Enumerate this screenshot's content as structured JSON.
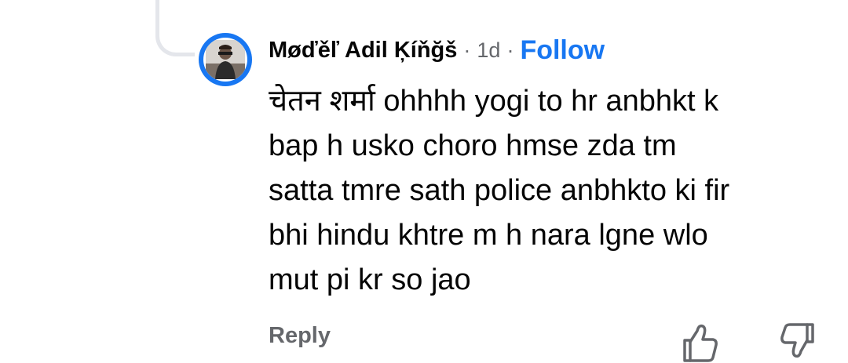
{
  "comment": {
    "author": "Møďěľ Adil Ķíňğš",
    "separator": "·",
    "time": "1d",
    "follow_label": "Follow",
    "text": "चेतन शर्मा ohhhh yogi to hr anbhkt k\nbap h usko choro  hmse zda tm\nsatta tmre sath police anbhkto ki fir\nbhi hindu khtre m h nara lgne wlo\nmut pi kr so jao",
    "reply_label": "Reply"
  },
  "icons": {
    "avatar": "profile-photo",
    "like": "thumbs-up-icon",
    "dislike": "thumbs-down-icon"
  },
  "colors": {
    "accent": "#1877f2",
    "text_primary": "#050505",
    "text_secondary": "#65676b",
    "thread_line": "#e4e6eb"
  }
}
